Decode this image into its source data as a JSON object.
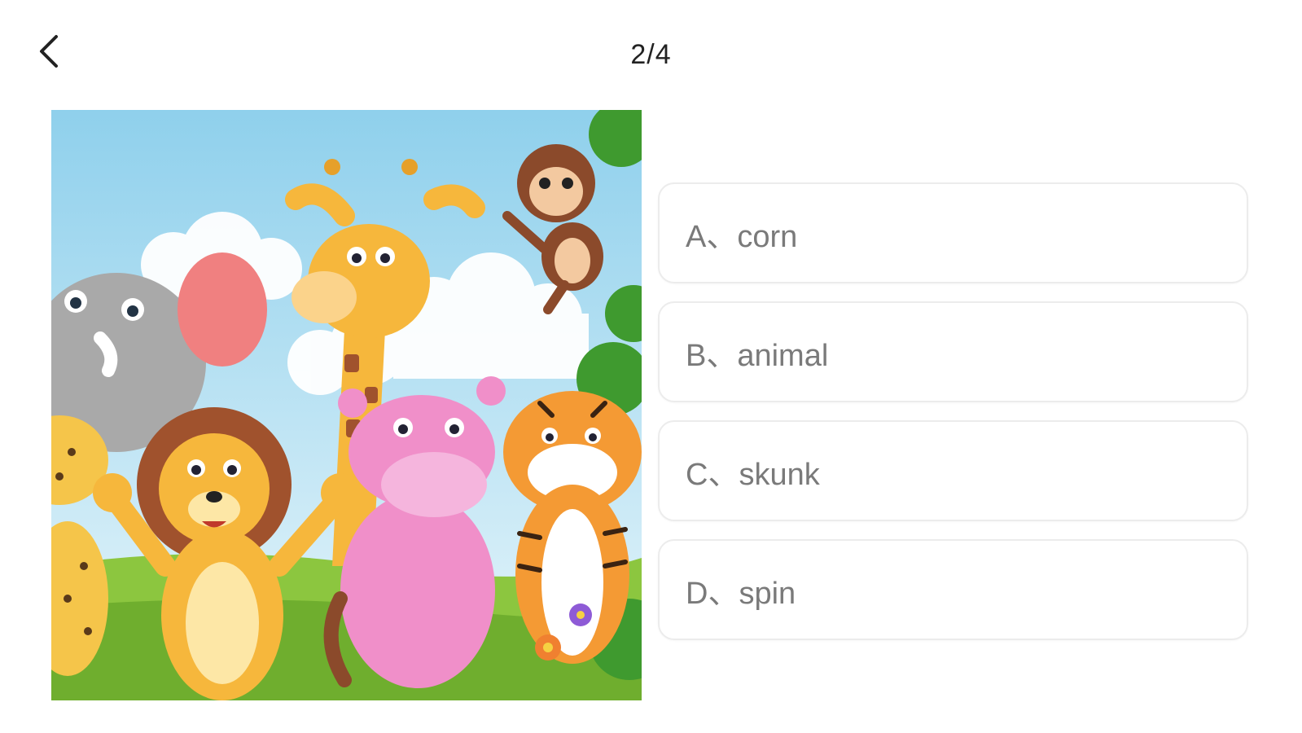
{
  "header": {
    "back_icon": "chevron-left-icon",
    "progress": "2/4"
  },
  "question": {
    "image": "cartoon-jungle-animals-illustration",
    "options": [
      {
        "label": "A、corn"
      },
      {
        "label": "B、animal"
      },
      {
        "label": "C、skunk"
      },
      {
        "label": "D、spin"
      }
    ]
  }
}
